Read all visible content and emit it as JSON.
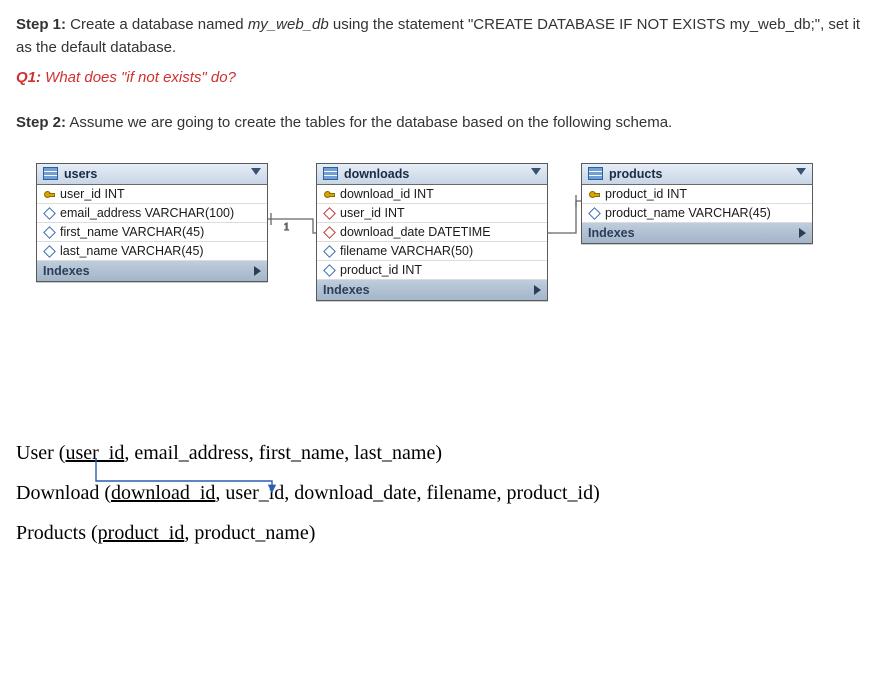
{
  "step1": {
    "label": "Step 1:",
    "text_a": " Create a database named ",
    "dbname": "my_web_db",
    "text_b": " using the statement \"CREATE DATABASE IF NOT EXISTS my_web_db;\", set it as the default database."
  },
  "q1": {
    "label": "Q1:",
    "text": " What does \"if not exists\" do?"
  },
  "step2": {
    "label": "Step 2:",
    "text": " Assume we are going to create the tables for the database based on the following schema."
  },
  "schema": {
    "indexes_label": "Indexes",
    "users": {
      "title": "users",
      "cols": [
        {
          "icon": "key",
          "text": "user_id INT"
        },
        {
          "icon": "blue",
          "text": "email_address VARCHAR(100)"
        },
        {
          "icon": "blue",
          "text": "first_name VARCHAR(45)"
        },
        {
          "icon": "blue",
          "text": "last_name VARCHAR(45)"
        }
      ]
    },
    "downloads": {
      "title": "downloads",
      "cols": [
        {
          "icon": "key",
          "text": "download_id INT"
        },
        {
          "icon": "red",
          "text": "user_id INT"
        },
        {
          "icon": "red",
          "text": "download_date DATETIME"
        },
        {
          "icon": "blue",
          "text": "filename VARCHAR(50)"
        },
        {
          "icon": "blue",
          "text": "product_id INT"
        }
      ]
    },
    "products": {
      "title": "products",
      "cols": [
        {
          "icon": "key",
          "text": "product_id INT"
        },
        {
          "icon": "blue",
          "text": "product_name VARCHAR(45)"
        }
      ]
    }
  },
  "relational": {
    "line1_a": "User (",
    "line1_key": "user_id",
    "line1_b": ", email_address, first_name, last_name)",
    "line2_a": "Download (",
    "line2_key": "download_id",
    "line2_b": ", user_id, download_date, filename, product_id)",
    "line3_a": "Products (",
    "line3_key": "product_id",
    "line3_b": ", product_name)"
  }
}
